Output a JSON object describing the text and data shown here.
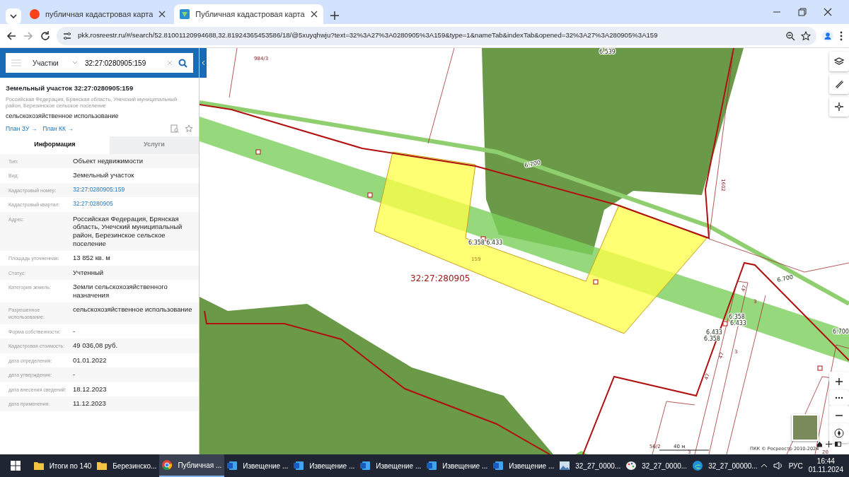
{
  "browser": {
    "tabs": [
      {
        "title": "публичная кадастровая карта",
        "selected": false
      },
      {
        "title": "Публичная кадастровая карта",
        "selected": true
      }
    ],
    "url": "pkk.rosreestr.ru/#/search/52.81001120994688,32.81924365453586/18/@5xuyqhwju?text=32%3A27%3A0280905%3A159&type=1&nameTab&indexTab&opened=32%3A27%3A280905%3A159"
  },
  "search": {
    "category": "Участки",
    "value": "32:27:0280905:159"
  },
  "object": {
    "title": "Земельный участок 32:27:0280905:159",
    "address": "Российская Федерация, Брянская область, Унечский муниципальный район, Березинское сельское поселение",
    "purpose": "сельскохозяйственное использование",
    "links": [
      "План ЗУ →",
      "План КК →"
    ]
  },
  "panel_tabs": [
    {
      "label": "Информация",
      "selected": true
    },
    {
      "label": "Услуги",
      "selected": false
    }
  ],
  "properties": [
    {
      "label": "Тип:",
      "value": "Объект недвижимости",
      "kind": "text"
    },
    {
      "label": "Вид:",
      "value": "Земельный участок",
      "kind": "text"
    },
    {
      "label": "Кадастровый номер:",
      "value": "32:27:0280905:159",
      "kind": "link"
    },
    {
      "label": "Кадастровый квартал:",
      "value": "32:27:0280905",
      "kind": "link"
    },
    {
      "label": "Адрес:",
      "value": "Российская Федерация, Брянская область, Унечский муниципальный район, Березинское сельское поселение",
      "kind": "text"
    },
    {
      "label": "Площадь уточненная:",
      "value": "13 852 кв. м",
      "kind": "text"
    },
    {
      "label": "Статус:",
      "value": "Учтенный",
      "kind": "text"
    },
    {
      "label": "Категория земель:",
      "value": "Земли сельскохозяйственного назначения",
      "kind": "text"
    },
    {
      "label": "Разрешенное использование:",
      "value": "сельскохозяйственное использование",
      "kind": "text"
    },
    {
      "label": "Форма собственности:",
      "value": "-",
      "kind": "text"
    },
    {
      "label": "Кадастровая стоимость:",
      "value": "49 036,08 руб.",
      "kind": "text"
    },
    {
      "label": "дата определения:",
      "value": "01.01.2022",
      "kind": "text"
    },
    {
      "label": "дата утверждения:",
      "value": "-",
      "kind": "text"
    },
    {
      "label": "дата внесения сведений:",
      "value": "18.12.2023",
      "kind": "text"
    },
    {
      "label": "дата применения:",
      "value": "11.12.2023",
      "kind": "text"
    }
  ],
  "map": {
    "labels": [
      {
        "text": "984/3",
        "kind": "parcel"
      },
      {
        "text": "6.539",
        "kind": "elevation"
      },
      {
        "text": "6.700",
        "kind": "elevation"
      },
      {
        "text": "1602",
        "kind": "parcel"
      },
      {
        "text": "6.358 6.433",
        "kind": "elevation"
      },
      {
        "text": "159",
        "kind": "parcel_yellow"
      },
      {
        "text": "32:27:280905",
        "kind": "quarter"
      },
      {
        "text": "6.700",
        "kind": "elevation"
      },
      {
        "text": "6.700",
        "kind": "elevation"
      },
      {
        "text": "6.358",
        "kind": "elevation"
      },
      {
        "text": "6.433",
        "kind": "elevation"
      },
      {
        "text": "6.433",
        "kind": "elevation"
      },
      {
        "text": "6.358",
        "kind": "elevation"
      },
      {
        "text": "47",
        "kind": "parcel"
      },
      {
        "text": "3",
        "kind": "parcel"
      },
      {
        "text": "47",
        "kind": "parcel"
      },
      {
        "text": "47",
        "kind": "parcel"
      },
      {
        "text": "3",
        "kind": "parcel"
      },
      {
        "text": "56/2",
        "kind": "parcel"
      },
      {
        "text": "3",
        "kind": "parcel"
      },
      {
        "text": "20",
        "kind": "parcel"
      }
    ],
    "scale": "40 м",
    "copyright": "ПКК © Росреестр 2010-2024"
  },
  "taskbar": {
    "items": [
      {
        "label": "Итоги по 140",
        "kind": "folder",
        "selected": false
      },
      {
        "label": "Березинско...",
        "kind": "folder",
        "selected": false
      },
      {
        "label": "Публичная ...",
        "kind": "chrome",
        "selected": true
      },
      {
        "label": "Извещение ...",
        "kind": "word",
        "selected": false
      },
      {
        "label": "Извещение ...",
        "kind": "word",
        "selected": false
      },
      {
        "label": "Извещение ...",
        "kind": "word",
        "selected": false
      },
      {
        "label": "Извещение ...",
        "kind": "word",
        "selected": false
      },
      {
        "label": "Извещение ...",
        "kind": "word",
        "selected": false
      },
      {
        "label": "32_27_0000...",
        "kind": "image",
        "selected": false
      },
      {
        "label": "32_27_0000...",
        "kind": "paint",
        "selected": false
      },
      {
        "label": "32_27_00000...",
        "kind": "edge",
        "selected": false
      }
    ],
    "language": "РУС",
    "time": "16:44",
    "date": "01.11.2024"
  }
}
